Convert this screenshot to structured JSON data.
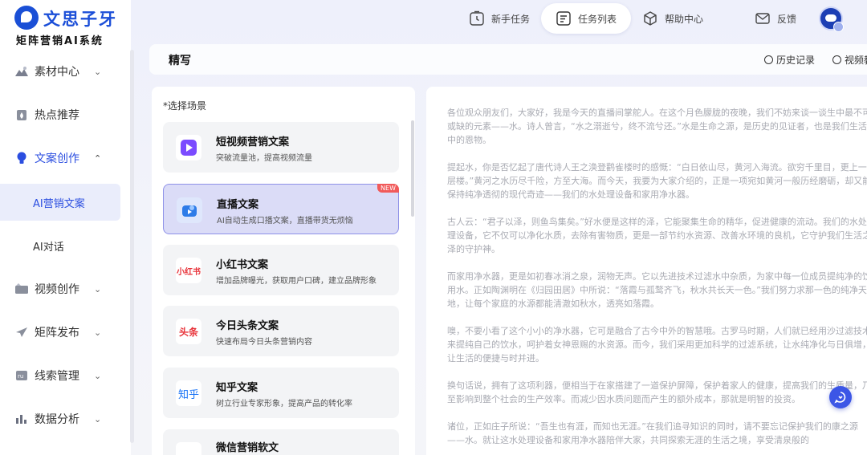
{
  "brand": {
    "name": "文思子牙",
    "subtitle": "矩阵营销AI系统",
    "color": "#1c4fd8"
  },
  "sidebar": {
    "items": [
      {
        "label": "素材中心",
        "icon": "mountain-image-icon",
        "expanded": false
      },
      {
        "label": "热点推荐",
        "icon": "fire-icon"
      },
      {
        "label": "文案创作",
        "icon": "lightbulb-icon",
        "expanded": true,
        "children": [
          {
            "label": "AI营销文案",
            "active": true
          },
          {
            "label": "AI对话",
            "active": false
          }
        ]
      },
      {
        "label": "视频创作",
        "icon": "video-folder-icon",
        "expanded": false
      },
      {
        "label": "矩阵发布",
        "icon": "paper-plane-icon",
        "expanded": false
      },
      {
        "label": "线索管理",
        "icon": "leads-icon",
        "expanded": false
      },
      {
        "label": "数据分析",
        "icon": "bar-chart-icon",
        "expanded": false
      }
    ]
  },
  "topnav": {
    "items": [
      {
        "label": "新手任务",
        "icon": "timer-icon",
        "active": false
      },
      {
        "label": "任务列表",
        "icon": "list-doc-icon",
        "active": true
      },
      {
        "label": "帮助中心",
        "icon": "cube-icon",
        "active": false
      },
      {
        "label": "反馈",
        "icon": "mail-icon",
        "active": false
      }
    ]
  },
  "header": {
    "title": "精写",
    "links": [
      {
        "label": "历史记录",
        "icon": "clock-icon"
      },
      {
        "label": "视频教",
        "icon": "play-circle-icon"
      }
    ]
  },
  "scene": {
    "label": "*选择场景",
    "cards": [
      {
        "title": "短视频营销文案",
        "desc": "突破流量池，提高视频流量",
        "icon": "purple-play-icon",
        "icon_color": "#7b4bff",
        "selected": false
      },
      {
        "title": "直播文案",
        "desc": "AI自动生成口播文案，直播带货无烦恼",
        "icon": "live-camera-icon",
        "icon_color": "#2e7ce8",
        "selected": true,
        "badge": "NEW"
      },
      {
        "title": "小红书文案",
        "desc": "增加品牌曝光，获取用户口碑，建立品牌形象",
        "icon_text": "小红书",
        "icon_color": "#e8333a",
        "selected": false
      },
      {
        "title": "今日头条文案",
        "desc": "快速布局今日头条营销内容",
        "icon_text": "头条",
        "icon_color": "#e8333a",
        "selected": false
      },
      {
        "title": "知乎文案",
        "desc": "树立行业专家形象，提高产品的转化率",
        "icon_text": "知乎",
        "icon_color": "#1772f6",
        "selected": false
      },
      {
        "title": "微信营销软文",
        "desc": "",
        "icon": "wechat-icon",
        "icon_color": "#2bb24c",
        "selected": false
      }
    ]
  },
  "content": {
    "paragraphs": [
      "各位观众朋友们，大家好，我是今天的直播间掌舵人。在这个月色朦胧的夜晚，我们不妨来谈一谈生中最不可或缺的元素——水。诗人曾言，“水之溺逝兮，终不流兮还。”水是生命之源，是历史的见证者，也是我们生活中的恩物。",
      "提起水，你是否忆起了唐代诗人王之涣登鹳雀楼时的感慨：“白日依山尽，黄河入海流。欲穷千里目，更上一层楼。”黄河之水历尽千险，方至大海。而今天，我要为大家介绍的，正是一项宛如黄河一般历经磨砺，却又能保持纯净透彻的现代奇迹——我们的水处理设备和家用净水器。",
      "古人云：“君子以泽，则鱼鸟集矣。”好水便是这样的泽，它能聚集生命的精华，促进健康的流动。我们的水处理设备，它不仅可以净化水质，去除有害物质，更是一部节约水资源、改善水环境的良机，它守护我们生活之泽的守护神。",
      "而家用净水器，更是如初春冰消之泉，润物无声。它以先进技术过滤水中杂质，为家中每一位成员提纯净的饮用水。正如陶渊明在《归园田居》中所说：“落霞与孤鹜齐飞，秋水共长天一色。”我们努力求那一色的纯净天地，让每个家庭的水源都能清澈如秋水，透亮如落霞。",
      "噢，不要小看了这个小小的净水器，它可是融合了古今中外的智慧哦。古罗马时期，人们就已经用沙过滤技术来提纯自己的饮水，呵护着女神恩赐的水资源。而今，我们采用更加科学的过滤系统，让水纯净化与日俱增，让生活的便捷与时并进。",
      "换句话说，拥有了这项利器，便相当于在家搭建了一道保护屏障，保护着家人的健康，提高我们的生质量，乃至影响到整个社会的生产效率。而减少因水质问题而产生的额外成本，那就是明智的投资。",
      "诸位，正如庄子所说：“吾生也有涯，而知也无涯。”在我们追寻知识的同时，请不要忘记保护我们的康之源——水。就让这水处理设备和家用净水器陪伴大家，共同探索无涯的生活之境，享受清泉般的"
    ]
  }
}
